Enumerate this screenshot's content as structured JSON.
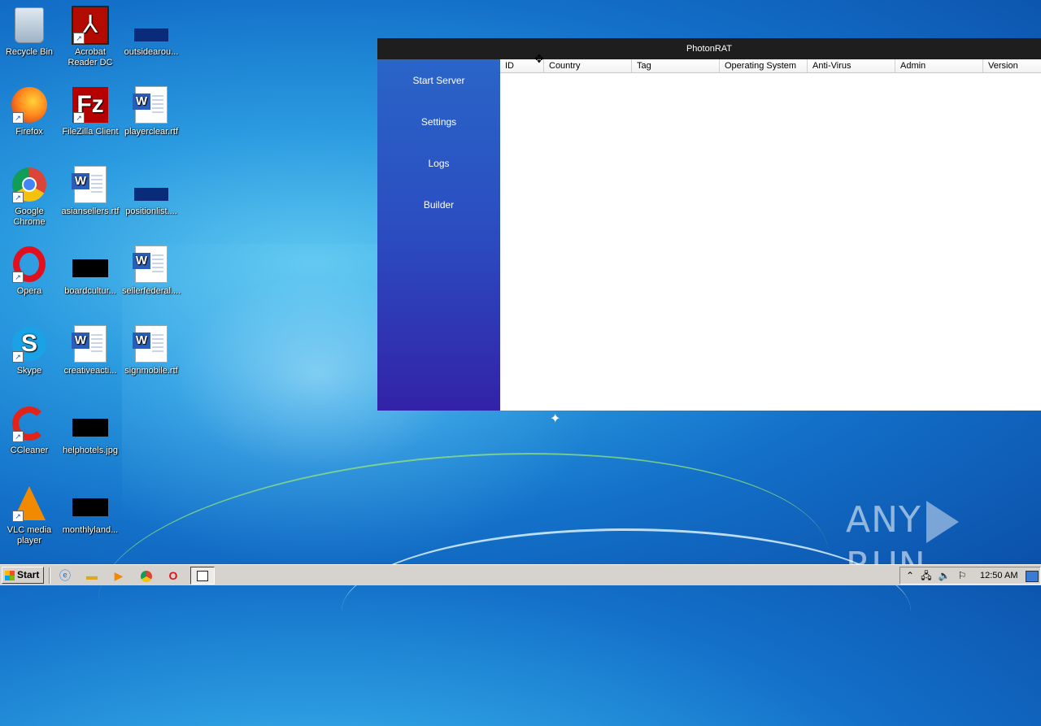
{
  "desktop": {
    "icons": [
      {
        "label": "Recycle Bin",
        "icon": "recycle-bin-icon"
      },
      {
        "label": "Acrobat Reader DC",
        "icon": "acrobat-icon"
      },
      {
        "label": "outsidearou...",
        "icon": "image-file-icon"
      },
      {
        "label": "Firefox",
        "icon": "firefox-icon"
      },
      {
        "label": "FileZilla Client",
        "icon": "filezilla-icon"
      },
      {
        "label": "playerclear.rtf",
        "icon": "word-document-icon"
      },
      {
        "label": "Google Chrome",
        "icon": "chrome-icon"
      },
      {
        "label": "asiansellers.rtf",
        "icon": "word-document-icon"
      },
      {
        "label": "positionlist....",
        "icon": "image-file-icon"
      },
      {
        "label": "Opera",
        "icon": "opera-icon"
      },
      {
        "label": "boardcultur...",
        "icon": "image-file-icon"
      },
      {
        "label": "sellerfederal....",
        "icon": "word-document-icon"
      },
      {
        "label": "Skype",
        "icon": "skype-icon"
      },
      {
        "label": "creativeacti...",
        "icon": "word-document-icon"
      },
      {
        "label": "signmobile.rtf",
        "icon": "word-document-icon"
      },
      {
        "label": "CCleaner",
        "icon": "ccleaner-icon"
      },
      {
        "label": "helphotels.jpg",
        "icon": "image-file-icon"
      },
      {
        "label": "VLC media player",
        "icon": "vlc-icon"
      },
      {
        "label": "monthlyland...",
        "icon": "image-file-icon"
      }
    ]
  },
  "window": {
    "title": "PhotonRAT",
    "sidebar": [
      "Start Server",
      "Settings",
      "Logs",
      "Builder"
    ],
    "columns": [
      "ID",
      "Country",
      "Tag",
      "Operating System",
      "Anti-Virus",
      "Admin",
      "Version"
    ]
  },
  "taskbar": {
    "start_label": "Start",
    "clock": "12:50 AM"
  },
  "watermark": {
    "left": "ANY",
    "right": "RUN"
  }
}
